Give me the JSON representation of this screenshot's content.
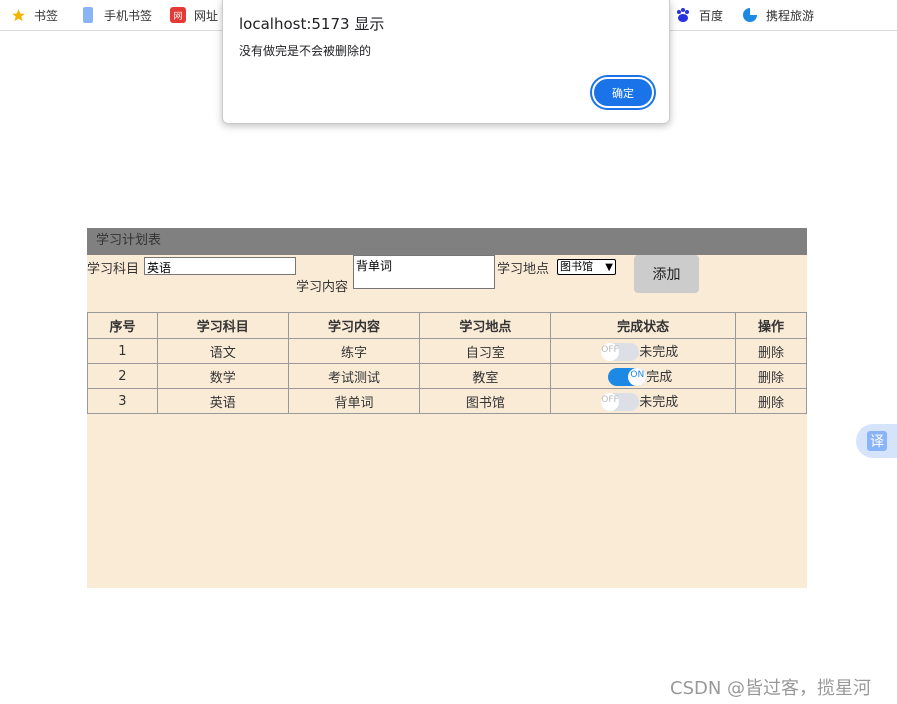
{
  "bookmarks": [
    {
      "label": "书签",
      "icon": "star-icon"
    },
    {
      "label": "手机书签",
      "icon": "phone-icon"
    },
    {
      "label": "网址",
      "icon": "site-icon"
    },
    {
      "label": "百度",
      "icon": "baidu-icon"
    },
    {
      "label": "携程旅游",
      "icon": "ctrip-icon"
    }
  ],
  "dialog": {
    "title": "localhost:5173 显示",
    "message": "没有做完是不会被删除的",
    "ok_label": "确定"
  },
  "panel": {
    "title": "学习计划表",
    "form": {
      "subject_label": "学习科目",
      "subject_value": "英语",
      "content_label": "学习内容",
      "content_value": "背单词",
      "location_label": "学习地点",
      "location_value": "图书馆",
      "add_label": "添加"
    },
    "table": {
      "headers": [
        "序号",
        "学习科目",
        "学习内容",
        "学习地点",
        "完成状态",
        "操作"
      ],
      "rows": [
        {
          "id": "1",
          "subject": "语文",
          "content": "练字",
          "location": "自习室",
          "switch": "OFF",
          "status": "未完成",
          "action": "删除"
        },
        {
          "id": "2",
          "subject": "数学",
          "content": "考试测试",
          "location": "教室",
          "switch": "ON",
          "status": "完成",
          "action": "删除"
        },
        {
          "id": "3",
          "subject": "英语",
          "content": "背单词",
          "location": "图书馆",
          "switch": "OFF",
          "status": "未完成",
          "action": "删除"
        }
      ]
    }
  },
  "translate_label": "译",
  "watermark": "CSDN @皆过客，揽星河",
  "colors": {
    "accent": "#1a73e8",
    "panel_bg": "#faebd7",
    "header_bg": "#808080",
    "switch_on": "#1e88e5"
  }
}
